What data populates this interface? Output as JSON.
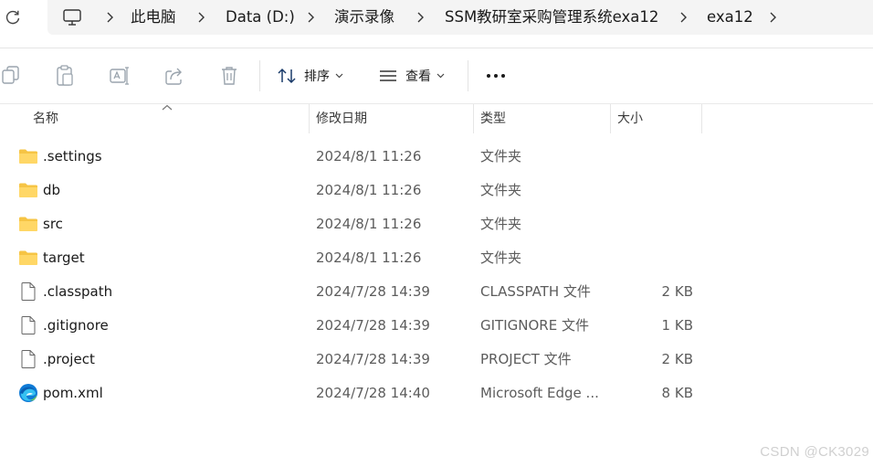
{
  "breadcrumb": [
    {
      "icon": "monitor-icon"
    },
    {
      "label": "此电脑"
    },
    {
      "label": "Data (D:)"
    },
    {
      "label": "演示录像"
    },
    {
      "label": "SSM教研室采购管理系统exa12"
    },
    {
      "label": "exa12"
    }
  ],
  "toolbar": {
    "copy_icon": "copy-icon",
    "paste_icon": "paste-icon",
    "rename_icon": "rename-icon",
    "share_icon": "share-icon",
    "delete_icon": "delete-icon",
    "sort_label": "排序",
    "view_label": "查看",
    "more_label": "..."
  },
  "columns": {
    "name": "名称",
    "modified": "修改日期",
    "type": "类型",
    "size": "大小"
  },
  "files": [
    {
      "icon": "folder-icon",
      "name": ".settings",
      "modified": "2024/8/1 11:26",
      "type": "文件夹",
      "size": ""
    },
    {
      "icon": "folder-icon",
      "name": "db",
      "modified": "2024/8/1 11:26",
      "type": "文件夹",
      "size": ""
    },
    {
      "icon": "folder-icon",
      "name": "src",
      "modified": "2024/8/1 11:26",
      "type": "文件夹",
      "size": ""
    },
    {
      "icon": "folder-icon",
      "name": "target",
      "modified": "2024/8/1 11:26",
      "type": "文件夹",
      "size": ""
    },
    {
      "icon": "file-icon",
      "name": ".classpath",
      "modified": "2024/7/28 14:39",
      "type": "CLASSPATH 文件",
      "size": "2 KB"
    },
    {
      "icon": "file-icon",
      "name": ".gitignore",
      "modified": "2024/7/28 14:39",
      "type": "GITIGNORE 文件",
      "size": "1 KB"
    },
    {
      "icon": "file-icon",
      "name": ".project",
      "modified": "2024/7/28 14:39",
      "type": "PROJECT 文件",
      "size": "2 KB"
    },
    {
      "icon": "edge-icon",
      "name": "pom.xml",
      "modified": "2024/7/28 14:40",
      "type": "Microsoft Edge ...",
      "size": "8 KB"
    }
  ],
  "colors": {
    "folder": "#f6c444",
    "edge": "#0f7bd6",
    "icon_disabled": "#9aa4ad"
  },
  "watermark": "CSDN @CK3029"
}
